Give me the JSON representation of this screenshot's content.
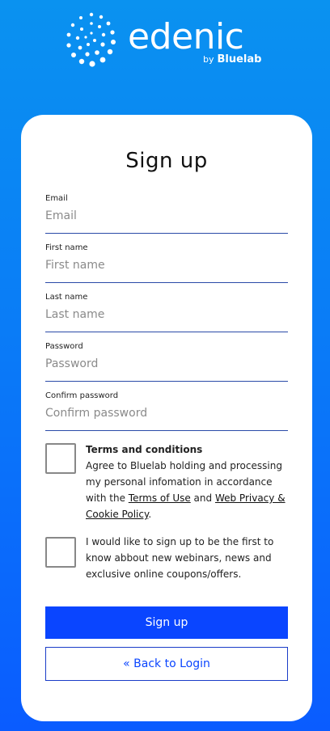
{
  "brand": {
    "name": "edenic",
    "by_text": "by",
    "partner": "Bluelab",
    "logo_icon": "dotted-circle-logo"
  },
  "form": {
    "title": "Sign up",
    "fields": [
      {
        "label": "Email",
        "placeholder": "Email",
        "value": ""
      },
      {
        "label": "First name",
        "placeholder": "First name",
        "value": ""
      },
      {
        "label": "Last name",
        "placeholder": "Last name",
        "value": ""
      },
      {
        "label": "Password",
        "placeholder": "Password",
        "value": ""
      },
      {
        "label": "Confirm password",
        "placeholder": "Confirm password",
        "value": ""
      }
    ],
    "terms": {
      "heading": "Terms and conditions",
      "text_before": "Agree to Bluelab holding and processing my personal infomation in accordance with the ",
      "link1": "Terms of Use",
      "text_mid": " and ",
      "link2": "Web Privacy & Cookie Policy",
      "text_after": ".",
      "checked": false
    },
    "newsletter": {
      "text": "I would like to sign up to be the first to know abbout new webinars, news and exclusive online coupons/offers.",
      "checked": false
    },
    "submit_label": "Sign up",
    "back_label": "« Back to Login"
  },
  "colors": {
    "accent": "#0a45ff",
    "background_top": "#0a92f0",
    "background_bottom": "#0a5cff"
  }
}
